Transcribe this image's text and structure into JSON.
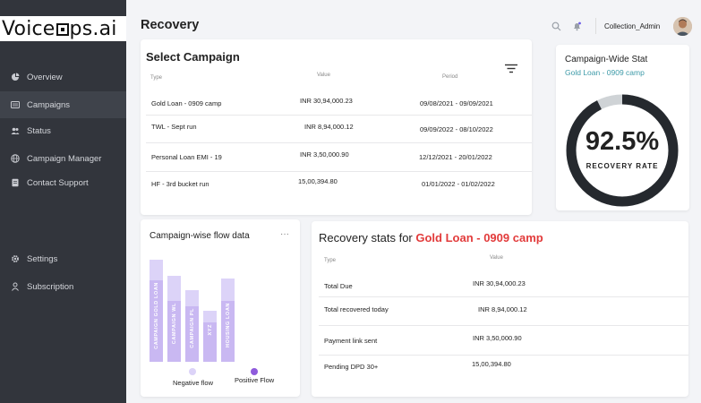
{
  "app": {
    "logo_left": "Voice",
    "logo_right": "ps.ai"
  },
  "sidebar": {
    "items": [
      {
        "label": "Overview",
        "icon": "pie-chart-icon",
        "active": false
      },
      {
        "label": "Campaigns",
        "icon": "list-icon",
        "active": true
      },
      {
        "label": "Status",
        "icon": "users-icon",
        "active": false
      },
      {
        "label": "Campaign Manager",
        "icon": "globe-icon",
        "active": false
      },
      {
        "label": "Contact Support",
        "icon": "document-icon",
        "active": false
      },
      {
        "label": "Settings",
        "icon": "gear-icon",
        "active": false
      },
      {
        "label": "Subscription",
        "icon": "person-icon",
        "active": false
      }
    ]
  },
  "header": {
    "title": "Recovery",
    "user_name": "Collection_Admin"
  },
  "select_campaign": {
    "title": "Select Campaign",
    "columns": [
      "Type",
      "Value",
      "Period"
    ],
    "rows": [
      {
        "type": "Gold Loan - 0909 camp",
        "value": "INR 30,94,000.23",
        "period": "09/08/2021 - 09/09/2021"
      },
      {
        "type": "TWL - Sept run",
        "value": "INR 8,94,000.12",
        "period": "09/09/2022 - 08/10/2022"
      },
      {
        "type": "Personal Loan EMI - 19",
        "value": "INR 3,50,000.90",
        "period": "12/12/2021 - 20/01/2022"
      },
      {
        "type": "HF - 3rd bucket run",
        "value": "15,00,394.80",
        "period": "01/01/2022 - 01/02/2022"
      }
    ]
  },
  "campaign_stat": {
    "title": "Campaign-Wide Stat",
    "subtitle": "Gold Loan - 0909 camp",
    "value": "92.5%",
    "label": "RECOVERY RATE",
    "fraction": 0.925,
    "ring_color": "#25292e",
    "track_color": "#cfd3d6"
  },
  "flow": {
    "title": "Campaign-wise flow data",
    "menu": "···",
    "legend_negative": "Negative flow",
    "legend_positive": "Positive Flow",
    "negative_color": "#dcd3f8",
    "positive_color": "#8f5bdc"
  },
  "chart_data": {
    "type": "bar",
    "categories": [
      "CAMPAIGN GOLD LOAN",
      "CAMPAIGN WL",
      "CAMPAIGN PL",
      "XYZ",
      "HOUSING LOAN"
    ],
    "series": [
      {
        "name": "Negative flow",
        "values": [
          1.0,
          0.84,
          0.7,
          0.5,
          0.82
        ]
      },
      {
        "name": "Positive Flow",
        "values": [
          0.8,
          0.6,
          0.54,
          0.39,
          0.6
        ]
      }
    ]
  },
  "recovery_stats": {
    "title_prefix": "Recovery stats for ",
    "title_highlight": "Gold Loan - 0909 camp",
    "columns": [
      "Type",
      "Value"
    ],
    "rows": [
      {
        "type": "Total Due",
        "value": "INR 30,94,000.23"
      },
      {
        "type": "Total recovered today",
        "value": "INR 8,94,000.12"
      },
      {
        "type": "Payment link sent",
        "value": "INR 3,50,000.90"
      },
      {
        "type": "Pending DPD 30+",
        "value": "15,00,394.80"
      }
    ]
  }
}
